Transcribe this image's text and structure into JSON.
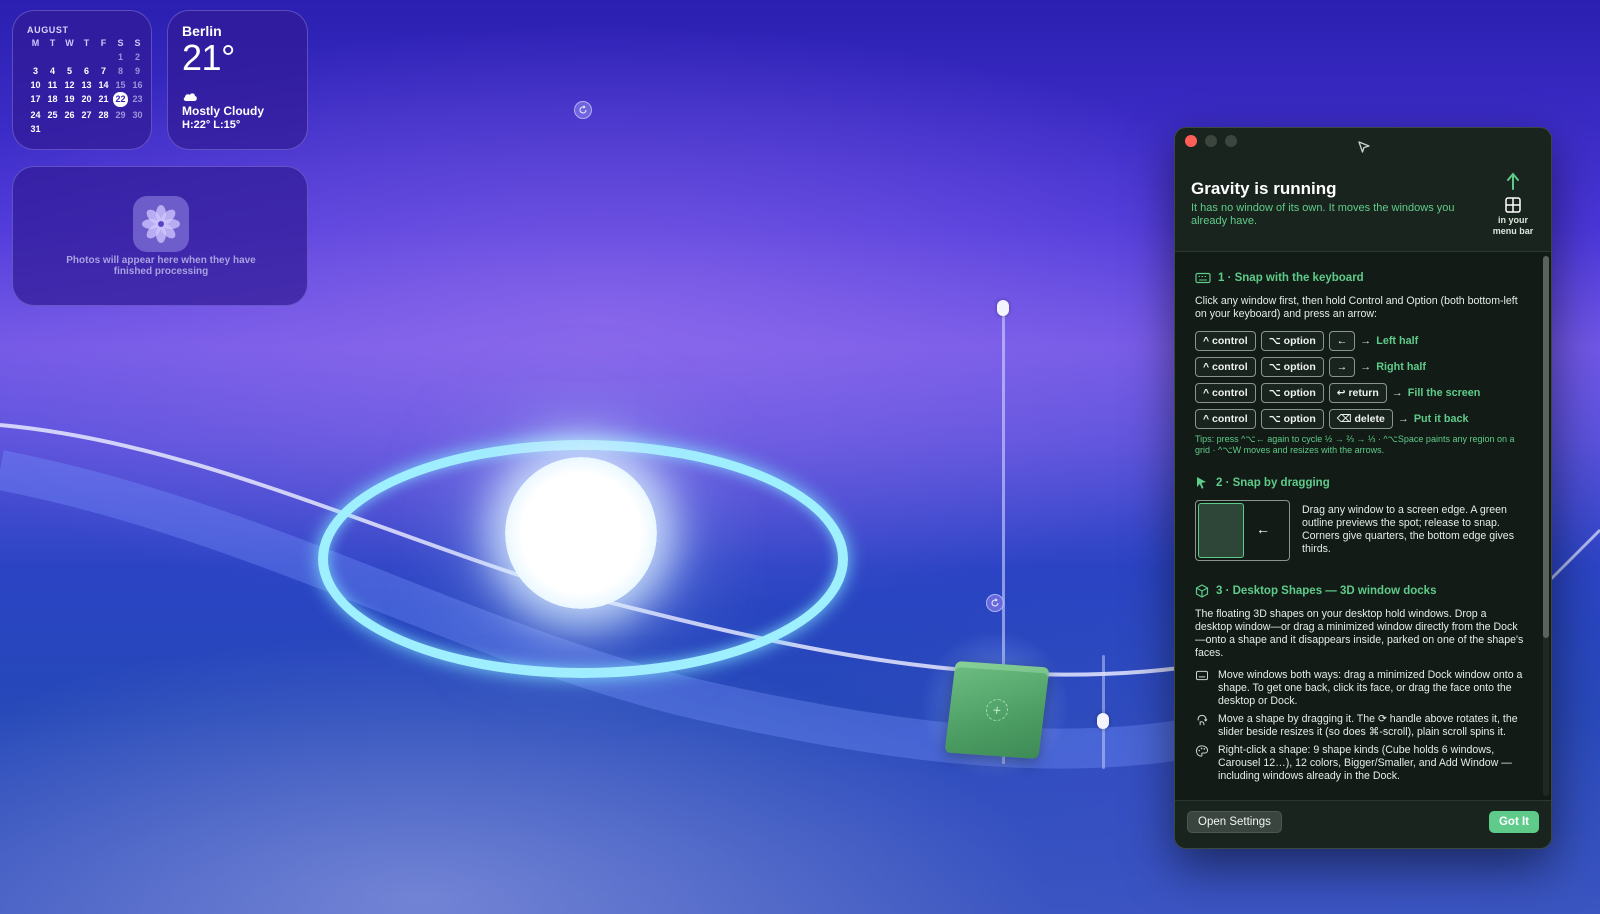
{
  "calendar": {
    "month": "AUGUST",
    "weekdays": [
      "M",
      "T",
      "W",
      "T",
      "F",
      "S",
      "S"
    ],
    "weeks": [
      [
        "",
        "",
        "",
        "",
        "",
        "1",
        "2"
      ],
      [
        "3",
        "4",
        "5",
        "6",
        "7",
        "8",
        "9"
      ],
      [
        "10",
        "11",
        "12",
        "13",
        "14",
        "15",
        "16"
      ],
      [
        "17",
        "18",
        "19",
        "20",
        "21",
        "22",
        "23"
      ],
      [
        "24",
        "25",
        "26",
        "27",
        "28",
        "29",
        "30"
      ],
      [
        "31",
        "",
        "",
        "",
        "",
        "",
        ""
      ]
    ],
    "today": "22"
  },
  "weather": {
    "city": "Berlin",
    "temperature": "21°",
    "condition": "Mostly Cloudy",
    "high_low": "H:22° L:15°",
    "icon": "cloud-icon"
  },
  "photos_widget": {
    "message": "Photos will appear here when they have finished processing",
    "icon": "photos-flower-icon"
  },
  "desktop_shapes": {
    "ring_shape": "ring",
    "cube_shape": "cube",
    "cube_color": "#5aae72",
    "ring_color": "#9ff0ff"
  },
  "window": {
    "title": "Gravity is running",
    "subtitle": "It has no window of its own. It moves the windows you already have.",
    "menubar_hint": "in your menu bar",
    "accent": "#5ecb8a",
    "section1": {
      "heading": "1 · Snap with the keyboard",
      "intro": "Click any window first, then hold Control and Option (both bottom-left on your keyboard) and press an arrow:",
      "rows": [
        {
          "k1": "^ control",
          "k2": "⌥ option",
          "k3": "←",
          "result": "Left half"
        },
        {
          "k1": "^ control",
          "k2": "⌥ option",
          "k3": "→",
          "result": "Right half"
        },
        {
          "k1": "^ control",
          "k2": "⌥ option",
          "k3": "↩ return",
          "result": "Fill the screen"
        },
        {
          "k1": "^ control",
          "k2": "⌥ option",
          "k3": "⌫ delete",
          "result": "Put it back"
        }
      ],
      "arrow": "→",
      "tips": "Tips: press ^⌥← again to cycle ½ → ⅔ → ⅓ · ^⌥Space paints any region on a grid · ^⌥W moves and resizes with the arrows."
    },
    "section2": {
      "heading": "2 · Snap by dragging",
      "text": "Drag any window to a screen edge. A green outline previews the spot; release to snap. Corners give quarters, the bottom edge gives thirds.",
      "demo_arrow": "←"
    },
    "section3": {
      "heading": "3 · Desktop Shapes — 3D window docks",
      "intro": "The floating 3D shapes on your desktop hold windows. Drop a desktop window—or drag a minimized window directly from the Dock—onto a shape and it disappears inside, parked on one of the shape's faces.",
      "bullets": [
        {
          "icon": "window-dock-icon",
          "text": "Move windows both ways: drag a minimized Dock window onto a shape. To get one back, click its face, or drag the face onto the desktop or Dock."
        },
        {
          "icon": "hand-rotate-icon",
          "text": "Move a shape by dragging it. The ⟳ handle above rotates it, the slider beside resizes it (so does ⌘-scroll), plain scroll spins it."
        },
        {
          "icon": "palette-icon",
          "text": "Right-click a shape: 9 shape kinds (Cube holds 6 windows, Carousel 12…), 12 colors, Bigger/Smaller, and Add Window — including windows already in the Dock."
        }
      ]
    },
    "buttons": {
      "settings": "Open Settings",
      "got_it": "Got It"
    }
  }
}
